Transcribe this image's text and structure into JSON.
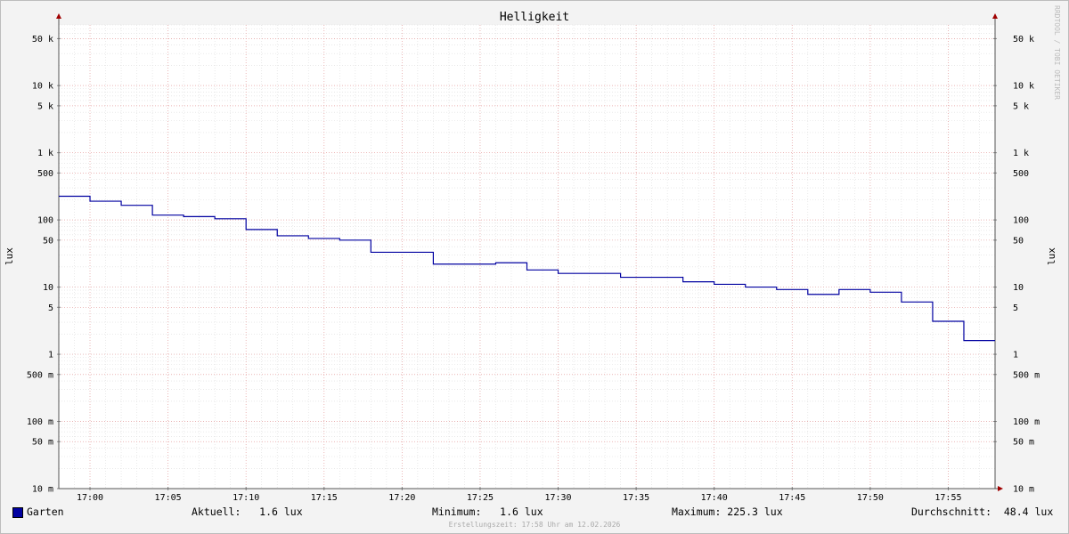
{
  "chart_data": {
    "type": "line",
    "title": "Helligkeit",
    "ylabel": "lux",
    "yscale": "log",
    "ylim": [
      0.01,
      80000
    ],
    "xlim": [
      "16:58",
      "17:58"
    ],
    "y_ticks": [
      {
        "v": 50000,
        "label": "50 k"
      },
      {
        "v": 10000,
        "label": "10 k"
      },
      {
        "v": 5000,
        "label": "5 k"
      },
      {
        "v": 1000,
        "label": "1 k"
      },
      {
        "v": 500,
        "label": "500"
      },
      {
        "v": 100,
        "label": "100"
      },
      {
        "v": 50,
        "label": "50"
      },
      {
        "v": 10,
        "label": "10"
      },
      {
        "v": 5,
        "label": "5"
      },
      {
        "v": 1,
        "label": "1"
      },
      {
        "v": 0.5,
        "label": "500 m"
      },
      {
        "v": 0.1,
        "label": "100 m"
      },
      {
        "v": 0.05,
        "label": "50 m"
      },
      {
        "v": 0.01,
        "label": "10 m"
      }
    ],
    "x_ticks": [
      "17:00",
      "17:05",
      "17:10",
      "17:15",
      "17:20",
      "17:25",
      "17:30",
      "17:35",
      "17:40",
      "17:45",
      "17:50",
      "17:55"
    ],
    "series": [
      {
        "name": "Garten",
        "color": "#0000a0",
        "step": true,
        "x": [
          "16:58",
          "17:00",
          "17:02",
          "17:04",
          "17:06",
          "17:08",
          "17:10",
          "17:12",
          "17:14",
          "17:16",
          "17:18",
          "17:20",
          "17:22",
          "17:24",
          "17:26",
          "17:28",
          "17:30",
          "17:32",
          "17:34",
          "17:36",
          "17:38",
          "17:40",
          "17:42",
          "17:44",
          "17:46",
          "17:48",
          "17:50",
          "17:52",
          "17:54",
          "17:56",
          "17:58"
        ],
        "values": [
          225.3,
          190,
          165,
          118,
          112,
          104,
          72,
          58,
          53,
          50,
          33,
          33,
          22,
          22,
          23,
          18,
          16,
          16,
          14,
          14,
          12,
          11,
          10,
          9.2,
          7.8,
          9.2,
          8.4,
          6,
          3.1,
          1.6,
          1.6
        ]
      }
    ],
    "grid": true
  },
  "legend": {
    "series_name": "Garten",
    "current": "Aktuell:   1.6 lux",
    "minimum": "Minimum:   1.6 lux",
    "maximum": "Maximum: 225.3 lux",
    "average": "Durchschnitt:  48.4 lux"
  },
  "footer": "Erstellungszeit: 17:58 Uhr am 12.02.2026",
  "watermark": "RRDTOOL / TOBI OETIKER"
}
